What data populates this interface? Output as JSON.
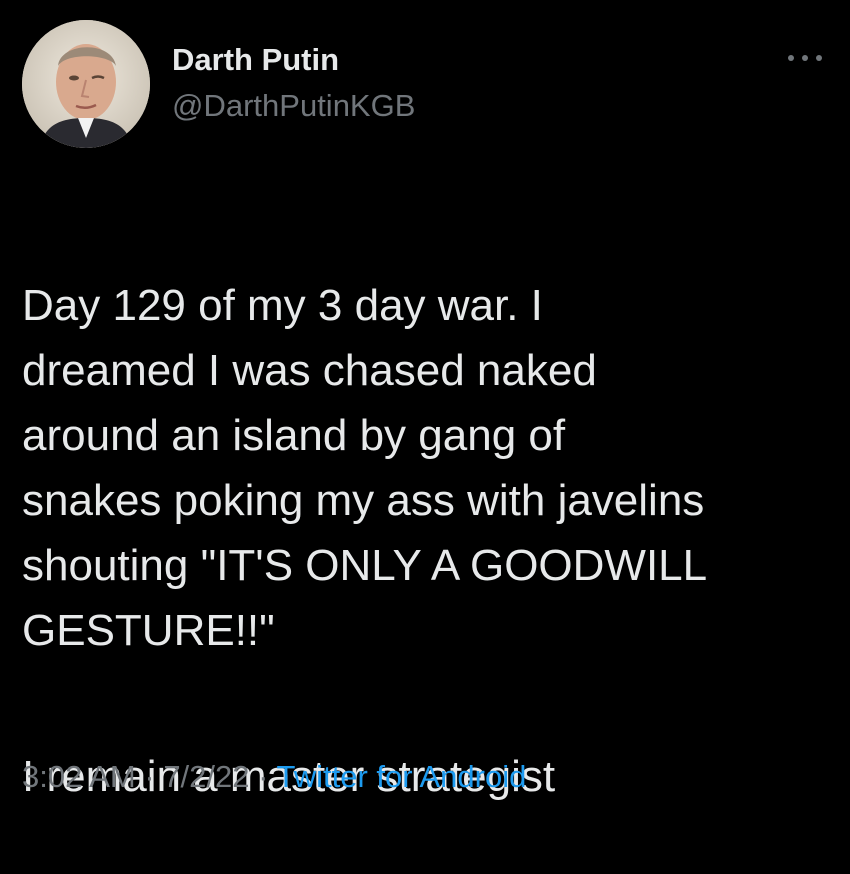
{
  "author": {
    "display_name": "Darth Putin",
    "handle": "@DarthPutinKGB",
    "avatar_icon": "profile-photo"
  },
  "more_icon": "ellipsis-icon",
  "tweet": {
    "paragraph1": "Day 129 of my 3 day war. I\ndreamed I was chased naked\naround an island by gang of\nsnakes poking my ass with javelins\nshouting \"IT'S ONLY A GOODWILL\nGESTURE!!\"",
    "paragraph2": "I remain a master strategist"
  },
  "meta": {
    "time": "3:02 AM",
    "separator1": " · ",
    "date": "7/2/22",
    "separator2": " · ",
    "source": "Twitter for Android"
  },
  "colors": {
    "background": "#000000",
    "primary_text": "#e7e9ea",
    "secondary_text": "#71767b",
    "link": "#1d9bf0"
  }
}
